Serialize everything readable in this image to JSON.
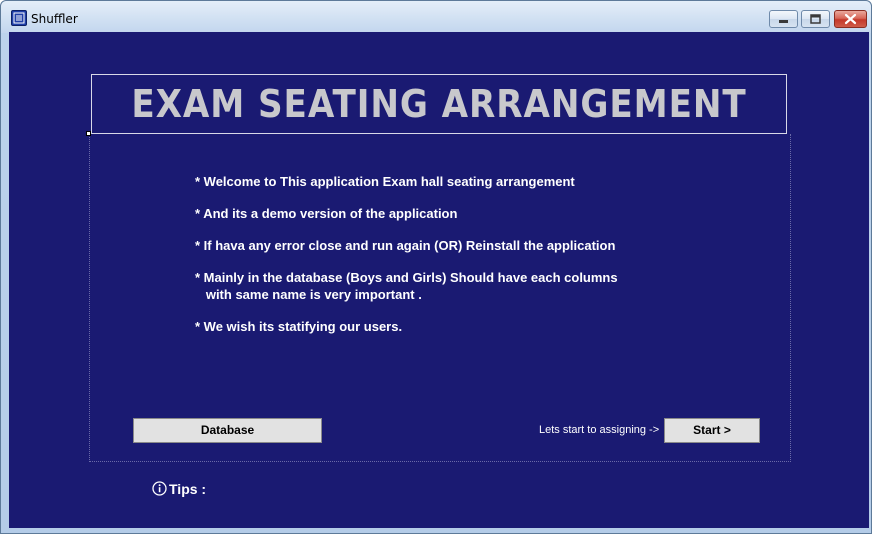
{
  "window": {
    "title": "Shuffler"
  },
  "banner": {
    "title": "EXAM SEATING ARRANGEMENT"
  },
  "info": {
    "lines": [
      "*  Welcome to This application Exam hall seating arrangement",
      "* And its a demo version of the application",
      "* If hava any error close and run again (OR) Reinstall the application",
      "* Mainly in the database (Boys and Girls) Should have each columns",
      "   with same name is very important .",
      "* We wish its statifying our users."
    ]
  },
  "actions": {
    "database_label": "Database",
    "hint": "Lets start to assigning ->",
    "start_label": "Start >"
  },
  "tips": {
    "label": "Tips :",
    "icon": "info-icon"
  },
  "colors": {
    "background": "#1a1a72",
    "banner_text": "#c8c8cc",
    "button_face": "#e2e2e2"
  }
}
